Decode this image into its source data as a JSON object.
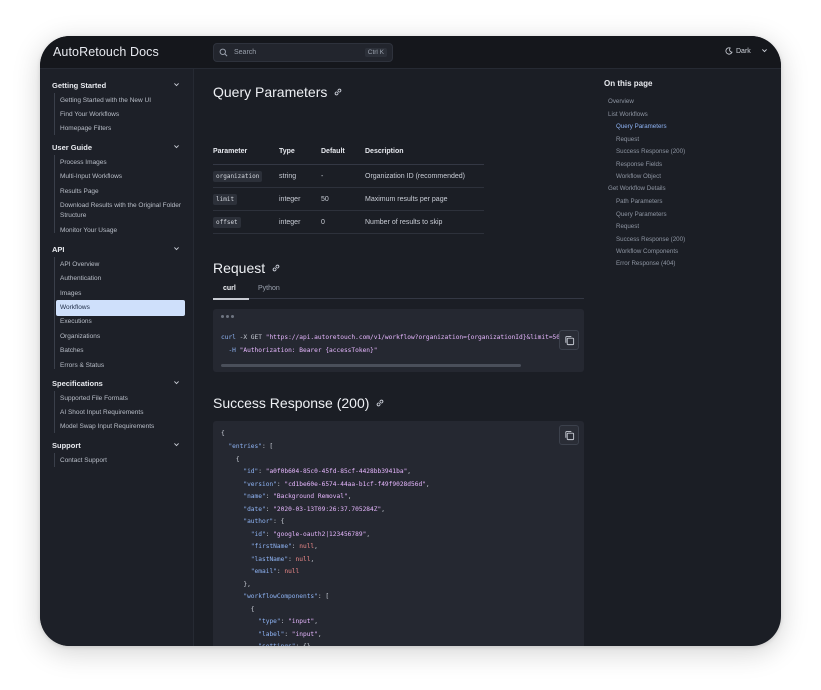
{
  "app": {
    "title": "AutoRetouch Docs"
  },
  "search": {
    "placeholder": "Search",
    "shortcut": "Ctrl K"
  },
  "theme": {
    "label": "Dark"
  },
  "sidebar": {
    "sections": [
      {
        "title": "Getting Started",
        "items": [
          "Getting Started with the New UI",
          "Find Your Workflows",
          "Homepage Filters"
        ]
      },
      {
        "title": "User Guide",
        "items": [
          "Process Images",
          "Multi-Input Workflows",
          "Results Page",
          "Download Results with the Original Folder Structure",
          "Monitor Your Usage"
        ]
      },
      {
        "title": "API",
        "items": [
          "API Overview",
          "Authentication",
          "Images",
          "Workflows",
          "Executions",
          "Organizations",
          "Batches",
          "Errors & Status"
        ]
      },
      {
        "title": "Specifications",
        "items": [
          "Supported File Formats",
          "AI Shoot Input Requirements",
          "Model Swap Input Requirements"
        ]
      },
      {
        "title": "Support",
        "items": [
          "Contact Support"
        ]
      }
    ],
    "active_item": "Workflows"
  },
  "main": {
    "query_heading": "Query Parameters",
    "params_table": {
      "headers": [
        "Parameter",
        "Type",
        "Default",
        "Description"
      ],
      "rows": [
        [
          "organization",
          "string",
          "-",
          "Organization ID (recommended)"
        ],
        [
          "limit",
          "integer",
          "50",
          "Maximum results per page"
        ],
        [
          "offset",
          "integer",
          "0",
          "Number of results to skip"
        ]
      ]
    },
    "request_heading": "Request",
    "tabs": [
      "curl",
      "Python"
    ],
    "active_tab": "curl",
    "curl_code": {
      "line1_cmd": "curl",
      "line1_flag": " -X GET ",
      "line1_url": "\"https://api.autoretouch.com/v1/workflow?organization={organizationId}&limit=50",
      "line2_flag": "  -H ",
      "line2_header": "\"Authorization: Bearer {accessToken}\""
    },
    "response_heading": "Success Response (200)",
    "response_json": {
      "id": "a0f0b604-85c0-45fd-85cf-4428bb3941ba",
      "version": "cd1be60e-6574-44aa-b1cf-f49f9028d56d",
      "name": "Background Removal",
      "date": "2020-03-13T09:26:37.705284Z",
      "author_id": "google-oauth2|123456789",
      "firstName": "null",
      "lastName": "null",
      "email": "null",
      "component_type": "input",
      "component_label": "input"
    }
  },
  "toc": {
    "title": "On this page",
    "items": [
      {
        "label": "Overview",
        "level": 0
      },
      {
        "label": "List Workflows",
        "level": 0
      },
      {
        "label": "Query Parameters",
        "level": 1,
        "active": true
      },
      {
        "label": "Request",
        "level": 1
      },
      {
        "label": "Success Response (200)",
        "level": 1
      },
      {
        "label": "Response Fields",
        "level": 1
      },
      {
        "label": "Workflow Object",
        "level": 1
      },
      {
        "label": "Get Workflow Details",
        "level": 0
      },
      {
        "label": "Path Parameters",
        "level": 1
      },
      {
        "label": "Query Parameters",
        "level": 1
      },
      {
        "label": "Request",
        "level": 1
      },
      {
        "label": "Success Response (200)",
        "level": 1
      },
      {
        "label": "Workflow Components",
        "level": 1
      },
      {
        "label": "Error Response (404)",
        "level": 1
      }
    ]
  },
  "colors": {
    "accent": "#8fb4f5",
    "active_bg": "#cfe0fb",
    "background": "#1b1e25"
  }
}
